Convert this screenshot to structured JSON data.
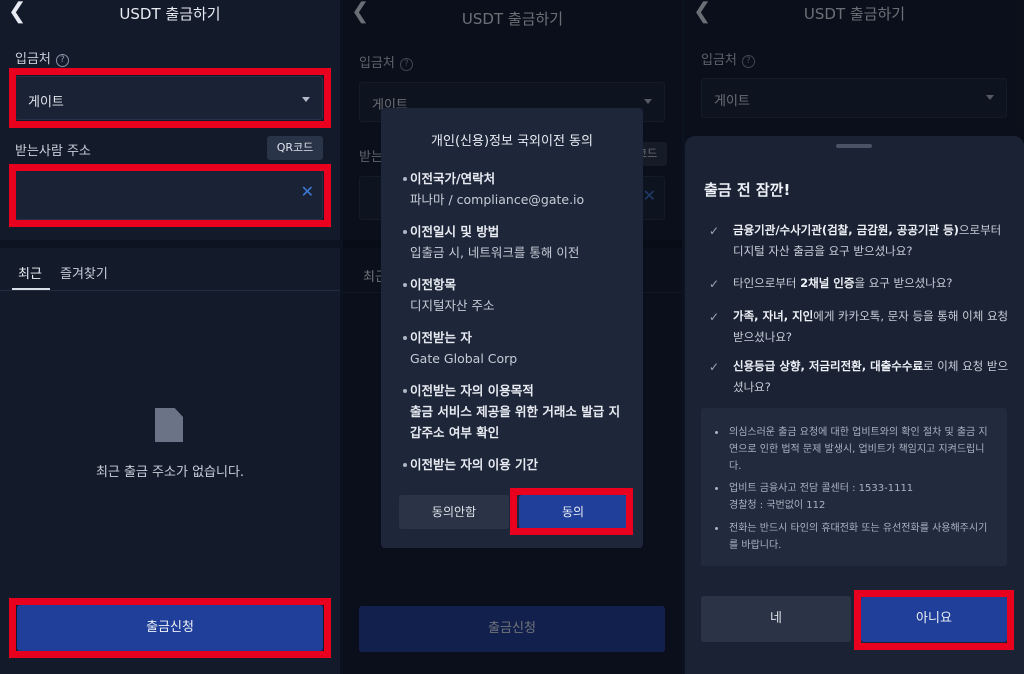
{
  "header": {
    "title": "USDT 출금하기",
    "back_glyph": "❮"
  },
  "form": {
    "destination_label": "입금처",
    "help_glyph": "?",
    "destination_value": "게이트",
    "recipient_label": "받는사람 주소",
    "qr_button": "QR코드",
    "clear_glyph": "✕"
  },
  "tabs": [
    {
      "label": "최근",
      "active": true
    },
    {
      "label": "즐겨찾기",
      "active": false
    }
  ],
  "empty_state": {
    "text": "최근 출금 주소가 없습니다."
  },
  "submit_label": "출금신청",
  "consent_modal": {
    "title": "개인(신용)정보 국외이전 동의",
    "items": [
      {
        "key": "이전국가/연락처",
        "value": "파나마 / compliance@gate.io"
      },
      {
        "key": "이전일시 및 방법",
        "value": "입출금 시, 네트워크를 통해 이전"
      },
      {
        "key": "이전항목",
        "value": "디지털자산 주소"
      },
      {
        "key": "이전받는 자",
        "value": "Gate Global Corp"
      },
      {
        "key": "이전받는 자의 이용목적",
        "value": "출금 서비스 제공을 위한 거래소 발급 지갑주소 여부 확인"
      },
      {
        "key": "이전받는 자의 이용 기간",
        "value": ""
      }
    ],
    "disagree_button": "동의안함",
    "agree_button": "동의"
  },
  "warning_sheet": {
    "title": "출금 전 잠깐!",
    "check_glyph": "✓",
    "checks": [
      {
        "bold": "금융기관/수사기관(검찰, 금감원, 공공기관 등)",
        "rest": "으로부터 디지털 자산 출금을 요구 받으셨나요?"
      },
      {
        "pre": "타인으로부터 ",
        "bold": "2채널 인증",
        "rest": "을 요구 받으셨나요?"
      },
      {
        "bold": "가족, 자녀, 지인",
        "rest": "에게 카카오톡, 문자 등을 통해 이체 요청 받으셨나요?"
      },
      {
        "bold": "신용등급 상향, 저금리전환, 대출수수료",
        "rest": "로 이체 요청 받으셨나요?"
      }
    ],
    "notices": [
      "의심스러운 출금 요청에 대한 업비트와의 확인 절차 및 출금 지연으로 인한 법적 문제 발생시, 업비트가 책임지고 지켜드립니다.",
      "업비트 금융사고 전담 콜센터 : 1533-1111\n경찰청 : 국번없이 112",
      "전화는 반드시 타인의 휴대전화 또는 유선전화를 사용해주시기를 바랍니다."
    ],
    "yes_button": "네",
    "no_button": "아니요"
  },
  "colors": {
    "background": "#131a2a",
    "primary_button": "#1f3f9a",
    "highlight_box": "#e8001e",
    "clear_icon": "#3e7bd6"
  }
}
